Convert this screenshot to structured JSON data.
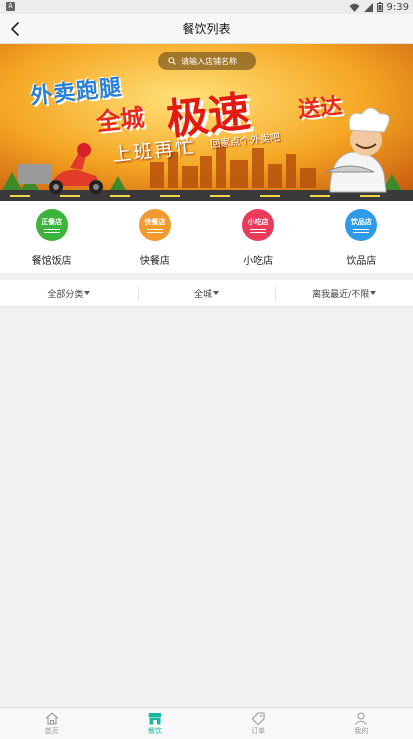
{
  "status_bar": {
    "left_glyph": "A",
    "time": "9:39"
  },
  "header": {
    "title": "餐饮列表",
    "back_icon": "chevron-left-icon"
  },
  "banner": {
    "search_placeholder": "请输入店铺名称",
    "line1": "外卖跑腿",
    "line2": "全城",
    "line3": "极速",
    "line4": "送达",
    "line5": "上班再忙",
    "line6": "回家点个外卖吧"
  },
  "categories": [
    {
      "badge": "正餐店",
      "label": "餐馆饭店",
      "color": "#3cb43c"
    },
    {
      "badge": "快餐店",
      "label": "快餐店",
      "color": "#f39a2e"
    },
    {
      "badge": "小吃店",
      "label": "小吃店",
      "color": "#ea3b5a"
    },
    {
      "badge": "饮品店",
      "label": "饮品店",
      "color": "#2f9be6"
    }
  ],
  "filters": [
    {
      "label": "全部分类"
    },
    {
      "label": "全城"
    },
    {
      "label": "离我最近/不限"
    }
  ],
  "bottom_nav": [
    {
      "label": "首页",
      "icon": "home-icon"
    },
    {
      "label": "餐饮",
      "icon": "store-icon",
      "active": true
    },
    {
      "label": "订单",
      "icon": "tag-icon"
    },
    {
      "label": "我的",
      "icon": "user-icon"
    }
  ],
  "colors": {
    "accent": "#1bb7a5"
  }
}
